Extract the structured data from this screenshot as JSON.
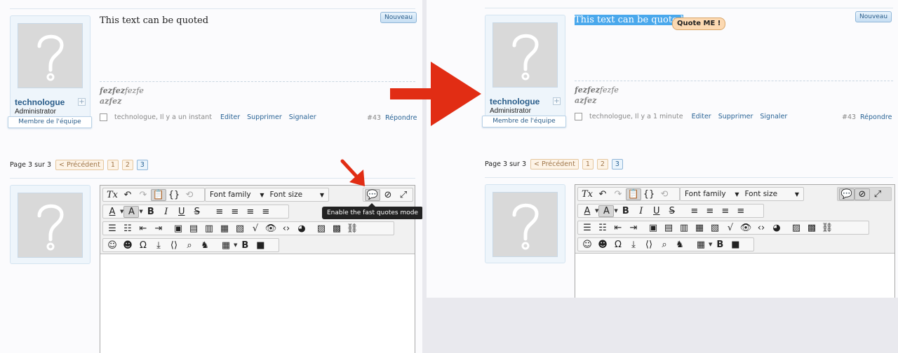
{
  "left": {
    "post_text": "This text can be quoted",
    "badge": "Nouveau",
    "author": {
      "name": "technologue",
      "rank": "Administrator",
      "group": "Membre de l'équipe",
      "plus": "+"
    },
    "signature": {
      "line1_bold": "fezfez",
      "line1_rest": "fezfe",
      "line2": "azfez"
    },
    "meta": {
      "byline": "technologue, Il y a un instant",
      "edit": "Editer",
      "delete": "Supprimer",
      "report": "Signaler",
      "post_num": "#43",
      "reply": "Répondre"
    },
    "pagination": {
      "label": "Page 3 sur 3",
      "prev": "< Précédent",
      "pages": [
        "1",
        "2",
        "3"
      ],
      "current": "3"
    },
    "tooltip": "Enable the fast quotes mode"
  },
  "right": {
    "post_text": "This text can be quoted",
    "quote_button": "Quote ME !",
    "badge": "Nouveau",
    "author": {
      "name": "technologue",
      "rank": "Administrator",
      "group": "Membre de l'équipe",
      "plus": "+"
    },
    "signature": {
      "line1_bold": "fezfez",
      "line1_rest": "fezfe",
      "line2": "azfez"
    },
    "meta": {
      "byline": "technologue, Il y a 1 minute",
      "edit": "Editer",
      "delete": "Supprimer",
      "report": "Signaler",
      "post_num": "#43",
      "reply": "Répondre"
    },
    "pagination": {
      "label": "Page 3 sur 3",
      "prev": "< Précédent",
      "pages": [
        "1",
        "2",
        "3"
      ],
      "current": "3"
    }
  },
  "editor": {
    "font_family": "Font family",
    "font_size": "Font size",
    "buttons": {
      "clear_format": "Tx",
      "undo": "↶",
      "redo": "↷",
      "paste": "📋",
      "source": "{}",
      "history": "⟲",
      "fast_quote": "💬",
      "no_sync": "⊘",
      "fullscreen": "⤢",
      "font_color": "A",
      "bg_color": "A",
      "bold": "B",
      "italic": "I",
      "underline": "U",
      "strike": "S",
      "align_left": "≡",
      "align_center": "≡",
      "align_right": "≡",
      "justify": "≡",
      "bullets": "☰",
      "numbered": "☷",
      "outdent": "⇤",
      "indent": "⇥",
      "img1": "▣",
      "img2": "▤",
      "doc": "▥",
      "doc2": "▦",
      "page": "▧",
      "sqrt": "√",
      "hide": "👁",
      "code": "‹›",
      "spoiler": "◕",
      "picture": "▨",
      "film": "▩",
      "link": "⛓",
      "smiley": "☺",
      "smiley2": "☻",
      "omega": "Ω",
      "upload": "⤓",
      "embed": "⟨⟩",
      "search": "⌕",
      "mask": "♞",
      "table": "▦",
      "b2": "B",
      "video": "■"
    }
  },
  "colors": {
    "arrow": "#e12d14",
    "link": "#2a6496",
    "selection": "#4aa8ec",
    "quote_bg": "#fcd9b2"
  }
}
